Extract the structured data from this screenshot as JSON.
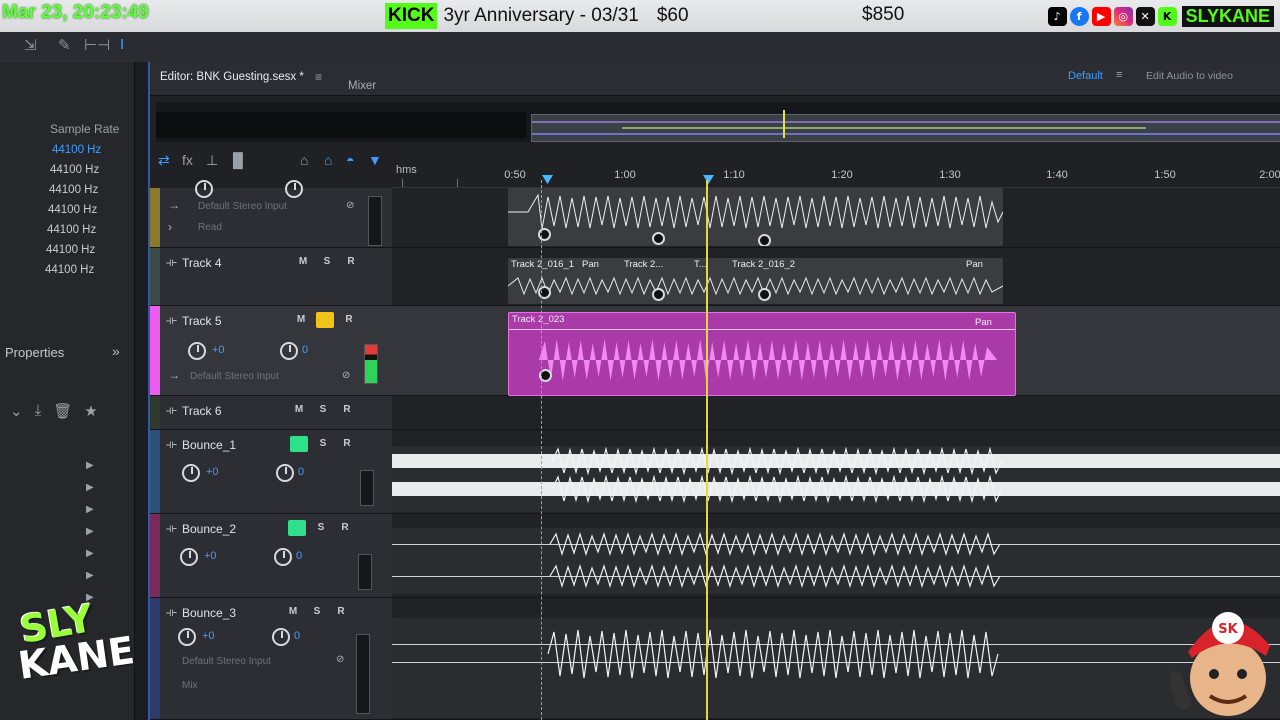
{
  "overlay": {
    "clock": "Mar 23, 20:23:49",
    "kick_badge": "KICK",
    "event": "3yr Anniversary - 03/31",
    "price": "$60",
    "goal": "$850",
    "handle": "SLYKANE",
    "social_icons": [
      "tiktok-icon",
      "facebook-icon",
      "youtube-icon",
      "instagram-icon",
      "x-icon",
      "kick-icon"
    ]
  },
  "tab": {
    "editor_label": "Editor: BNK Guesting.sesx *",
    "mixer_label": "Mixer",
    "workspace": "Default",
    "hint": "Edit Audio to video"
  },
  "left_panel": {
    "sample_rate_label": "Sample Rate",
    "sample_rates": [
      "44100 Hz",
      "44100 Hz",
      "44100 Hz",
      "44100 Hz",
      "44100 Hz",
      "44100 Hz",
      "44100 Hz"
    ],
    "properties_label": "Properties"
  },
  "ruler": {
    "unit": "hms",
    "ticks": [
      "0:50",
      "1:00",
      "1:10",
      "1:20",
      "1:30",
      "1:40",
      "1:50",
      "2:00"
    ]
  },
  "tracks": [
    {
      "name": "",
      "input": "Default Stereo Input",
      "mode": "Read"
    },
    {
      "name": "Track 4",
      "m": "M",
      "s": "S",
      "r": "R"
    },
    {
      "name": "Track 5",
      "m": "M",
      "s": "S",
      "r": "R",
      "vol": "+0",
      "pan": "0",
      "input": "Default Stereo Input"
    },
    {
      "name": "Track 6",
      "m": "M",
      "s": "S",
      "r": "R"
    },
    {
      "name": "Bounce_1",
      "m": "M",
      "s": "S",
      "r": "R",
      "vol": "+0",
      "pan": "0"
    },
    {
      "name": "Bounce_2",
      "m": "M",
      "s": "S",
      "r": "R",
      "vol": "+0",
      "pan": "0"
    },
    {
      "name": "Bounce_3",
      "m": "M",
      "s": "S",
      "r": "R",
      "vol": "+0",
      "pan": "0",
      "input": "Default Stereo Input",
      "mode": "Mix"
    }
  ],
  "clips": {
    "track4": [
      "Track 2_016_1",
      "Pan",
      "Track 2...",
      "T...",
      "Track 2_016_2",
      "Pan"
    ],
    "track5": [
      "Track 2_023",
      "Pan"
    ]
  },
  "watermark": {
    "line1": "SLY",
    "line2": "KANE",
    "mascot_badge": "SK"
  },
  "colors": {
    "accent": "#3d9eff",
    "playhead": "#e2da3a",
    "track5": "#c43fc3",
    "kick": "#53fc18"
  }
}
